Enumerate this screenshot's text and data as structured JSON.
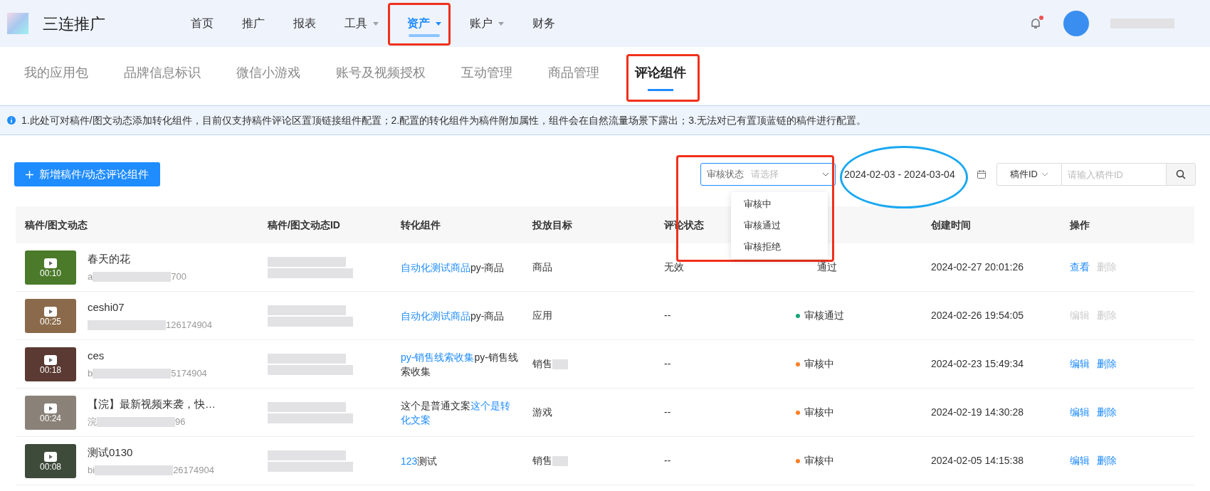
{
  "brand": {
    "name": "三连推广"
  },
  "nav": [
    {
      "label": "首页",
      "selected": false,
      "dropdown": false
    },
    {
      "label": "推广",
      "selected": false,
      "dropdown": false
    },
    {
      "label": "报表",
      "selected": false,
      "dropdown": false
    },
    {
      "label": "工具",
      "selected": false,
      "dropdown": true
    },
    {
      "label": "资产",
      "selected": true,
      "dropdown": true
    },
    {
      "label": "账户",
      "selected": false,
      "dropdown": true
    },
    {
      "label": "财务",
      "selected": false,
      "dropdown": false
    }
  ],
  "notifications": {
    "unread": true
  },
  "subtabs": [
    {
      "label": "我的应用包",
      "selected": false
    },
    {
      "label": "品牌信息标识",
      "selected": false
    },
    {
      "label": "微信小游戏",
      "selected": false
    },
    {
      "label": "账号及视频授权",
      "selected": false
    },
    {
      "label": "互动管理",
      "selected": false
    },
    {
      "label": "商品管理",
      "selected": false
    },
    {
      "label": "评论组件",
      "selected": true
    }
  ],
  "notice": "1.此处可对稿件/图文动态添加转化组件，目前仅支持稿件评论区置顶链接组件配置；2.配置的转化组件为稿件附加属性，组件会在自然流量场景下露出；3.无法对已有置顶蓝链的稿件进行配置。",
  "toolbar": {
    "add_button": "新增稿件/动态评论组件",
    "status_filter": {
      "label": "审核状态",
      "placeholder": "请选择",
      "expanded": true,
      "options": [
        "审核中",
        "审核通过",
        "审核拒绝"
      ]
    },
    "date_range": "2024-02-03 - 2024-03-04",
    "id_filter": {
      "label": "稿件ID",
      "placeholder": "请输入稿件ID"
    }
  },
  "table": {
    "columns": [
      {
        "label": "稿件/图文动态"
      },
      {
        "label": "稿件/图文动态ID"
      },
      {
        "label": "转化组件"
      },
      {
        "label": "投放目标"
      },
      {
        "label": "评论状态"
      },
      {
        "covered": true
      },
      {
        "label": "创建时间"
      },
      {
        "label": "操作"
      }
    ],
    "rows": [
      {
        "duration": "00:10",
        "title": "春天的花",
        "id_head": "a",
        "id_tail": "700",
        "component": [
          {
            "text": "自动化测试商品",
            "link": true
          },
          {
            "text": "py-商品",
            "link": false
          }
        ],
        "target": "商品",
        "target_blurred": false,
        "comment_status": "无效",
        "review": {
          "text": "通过"
        },
        "created": "2024-02-27 20:01:26",
        "actions": [
          {
            "label": "查看",
            "disabled": false
          },
          {
            "label": "删除",
            "disabled": true
          }
        ]
      },
      {
        "duration": "00:25",
        "title": "ceshi07",
        "id_head": "",
        "id_tail": "126174904",
        "component": [
          {
            "text": "自动化测试商品",
            "link": true
          },
          {
            "text": "py-商品",
            "link": false
          }
        ],
        "target": "应用",
        "target_blurred": false,
        "comment_status": "--",
        "review": {
          "text": "审核通过",
          "color": "#17a673"
        },
        "created": "2024-02-26 19:54:05",
        "actions": [
          {
            "label": "编辑",
            "disabled": true
          },
          {
            "label": "删除",
            "disabled": true
          }
        ]
      },
      {
        "duration": "00:18",
        "title": "ces",
        "id_head": "b",
        "id_tail": "5174904",
        "component": [
          {
            "text": "py-销售线索收集",
            "link": true
          },
          {
            "text": "py-销售线索收集",
            "link": false
          }
        ],
        "target": "销售",
        "target_blurred": true,
        "comment_status": "--",
        "review": {
          "text": "审核中",
          "color": "#ff7f24"
        },
        "created": "2024-02-23 15:49:34",
        "actions": [
          {
            "label": "编辑",
            "disabled": false
          },
          {
            "label": "删除",
            "disabled": false
          }
        ]
      },
      {
        "duration": "00:24",
        "title": "【浣】最新视频来袭，快…",
        "id_head": "浣",
        "id_tail": "96",
        "component": [
          {
            "text": "这个是普通文案",
            "link": false
          },
          {
            "text": "这个是转化文案",
            "link": true
          }
        ],
        "target": "游戏",
        "target_blurred": false,
        "comment_status": "--",
        "review": {
          "text": "审核中",
          "color": "#ff7f24"
        },
        "created": "2024-02-19 14:30:28",
        "actions": [
          {
            "label": "编辑",
            "disabled": false
          },
          {
            "label": "删除",
            "disabled": false
          }
        ]
      },
      {
        "duration": "00:08",
        "title": "测试0130",
        "id_head": "bi",
        "id_tail": "26174904",
        "component": [
          {
            "text": "123",
            "link": true
          },
          {
            "text": "测试",
            "link": false
          }
        ],
        "target": "销售",
        "target_blurred": true,
        "comment_status": "--",
        "review": {
          "text": "审核中",
          "color": "#ff7f24"
        },
        "created": "2024-02-05 14:15:38",
        "actions": [
          {
            "label": "编辑",
            "disabled": false
          },
          {
            "label": "删除",
            "disabled": false
          }
        ]
      }
    ]
  }
}
